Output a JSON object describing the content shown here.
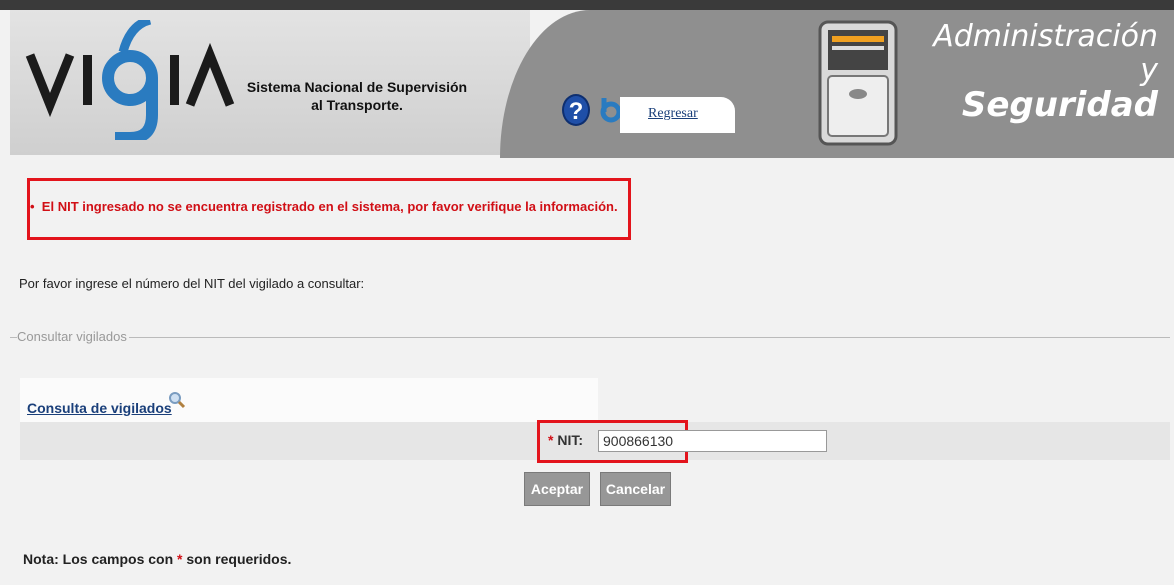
{
  "header": {
    "logo_text": "VIGIA",
    "system_name_line1": "Sistema Nacional de Supervisión",
    "system_name_line2": "al Transporte.",
    "help_icon": "question-icon",
    "back_link": "Regresar",
    "module_title_line1": "Administración y",
    "module_title_line2": "Seguridad"
  },
  "error": {
    "bullet": "•",
    "message": "El NIT ingresado no se encuentra registrado en el sistema, por favor verifique la información."
  },
  "instructions": "Por favor ingrese el número del NIT del vigilado a consultar:",
  "fieldset": {
    "legend": "Consultar vigilados"
  },
  "panel": {
    "title": "Consulta de vigilados",
    "icon": "search-icon"
  },
  "form": {
    "nit_required_mark": "*",
    "nit_label": "NIT:",
    "nit_value": "900866130"
  },
  "buttons": {
    "accept": "Aceptar",
    "cancel": "Cancelar"
  },
  "note": {
    "prefix": "Nota: Los campos con",
    "required_mark": "*",
    "suffix": "son requeridos."
  },
  "colors": {
    "error_red": "#d10f16",
    "link_blue": "#1a3f7a",
    "header_gray": "#8f8f8f"
  }
}
